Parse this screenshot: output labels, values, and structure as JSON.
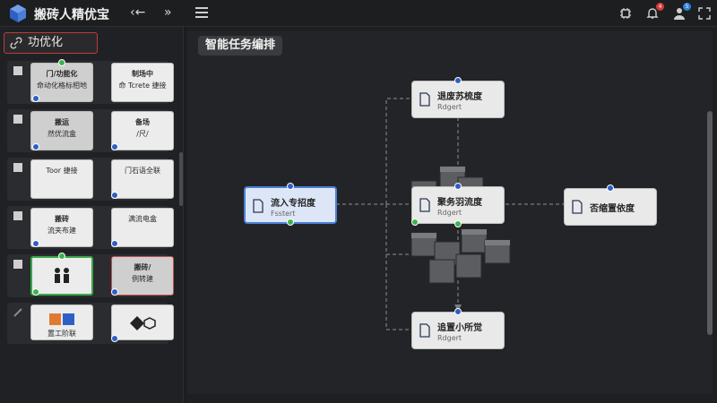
{
  "app": {
    "title": "搬砖人精优宝",
    "back_glyph": "‹←",
    "collapse_glyph": "»",
    "notification_count": "4",
    "user_count": "5"
  },
  "sidebar": {
    "section_label": "功优化",
    "rows": [
      {
        "left": {
          "l1": "门/功能化",
          "l2": "命动化格标相地"
        },
        "right": {
          "l1": "制场中",
          "l2": "命 Tcrete 捷接"
        }
      },
      {
        "left": {
          "l1": "搬运",
          "l2": "然优流盒"
        },
        "right": {
          "l1": "备场",
          "l2": "/尺/"
        }
      },
      {
        "left": {
          "l1": "",
          "l2": "Toor 捷接"
        },
        "right": {
          "l1": "",
          "l2": "门石语全联"
        }
      },
      {
        "left": {
          "l1": "搬砖",
          "l2": "流夹布建"
        },
        "right": {
          "l1": "",
          "l2": "满流电盒"
        }
      },
      {
        "left": {
          "l1": "",
          "l2": ""
        },
        "right": {
          "l1": "搬砖/",
          "l2": "例转建"
        }
      },
      {
        "left": {
          "l1": "",
          "l2": "置工阶联"
        },
        "right": {
          "l1": "",
          "l2": ""
        }
      }
    ]
  },
  "canvas": {
    "title": "智能任务编排",
    "nodes": {
      "input": {
        "title": "流入专招度",
        "sub": "Fsstert"
      },
      "top": {
        "title": "退废苏梳度",
        "sub": "Rdgert"
      },
      "center": {
        "title": "聚务羽流度",
        "sub": "Rdgert"
      },
      "right": {
        "title": "否缩置依度",
        "sub": ""
      },
      "bottom": {
        "title": "追置小所觉",
        "sub": "Rdgert"
      }
    }
  },
  "colors": {
    "accent_blue": "#2f5fc4",
    "accent_green": "#3db24a",
    "alert_red": "#c03a3a",
    "background": "#1b1c1e"
  },
  "icons": [
    "logo-cube-icon",
    "back-arrow-icon",
    "collapse-icon",
    "menu-icon",
    "chip-icon",
    "bell-icon",
    "user-icon",
    "expand-icon",
    "link-icon",
    "document-icon",
    "cube-cluster-icon"
  ]
}
